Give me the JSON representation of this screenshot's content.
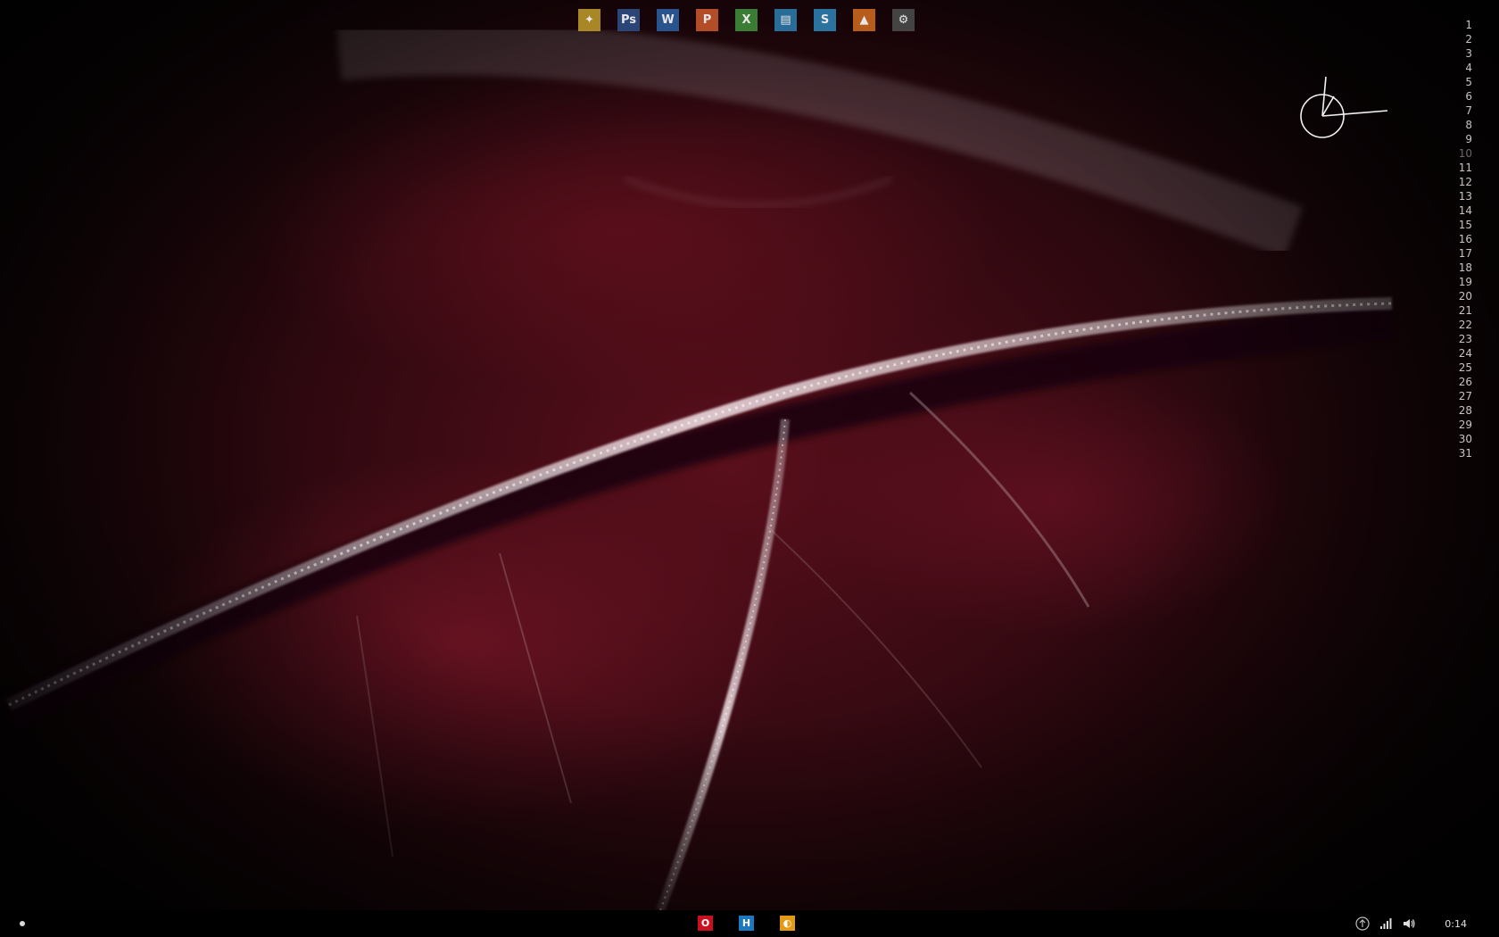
{
  "launcher": {
    "items": [
      {
        "name": "Launcher",
        "icon": "rocket-icon",
        "color": "#b9962a",
        "glyph": "✦"
      },
      {
        "name": "Photoshop",
        "icon": "photoshop-icon",
        "color": "#2d4d82",
        "glyph": "Ps"
      },
      {
        "name": "Word",
        "icon": "word-icon",
        "color": "#2a5c9c",
        "glyph": "W"
      },
      {
        "name": "PowerPoint",
        "icon": "powerpoint-icon",
        "color": "#c4552b",
        "glyph": "P"
      },
      {
        "name": "Excel",
        "icon": "excel-icon",
        "color": "#3f8a3a",
        "glyph": "X"
      },
      {
        "name": "Explorer",
        "icon": "folder-icon",
        "color": "#2b78a8",
        "glyph": "▤"
      },
      {
        "name": "Skype",
        "icon": "skype-icon",
        "color": "#2c7fb0",
        "glyph": "S"
      },
      {
        "name": "VLC",
        "icon": "vlc-icon",
        "color": "#c9661e",
        "glyph": "▲"
      },
      {
        "name": "Settings",
        "icon": "gear-icon",
        "color": "#4a4a4a",
        "glyph": "⚙"
      }
    ]
  },
  "calendar": {
    "days": [
      "1",
      "2",
      "3",
      "4",
      "5",
      "6",
      "7",
      "8",
      "9",
      "10",
      "11",
      "12",
      "13",
      "14",
      "15",
      "16",
      "17",
      "18",
      "19",
      "20",
      "21",
      "22",
      "23",
      "24",
      "25",
      "26",
      "27",
      "28",
      "29",
      "30",
      "31"
    ],
    "muted": [
      "10"
    ]
  },
  "taskbar": {
    "pinned": [
      {
        "name": "Opera",
        "icon": "opera-icon",
        "color": "#c8101e",
        "glyph": "O"
      },
      {
        "name": "App",
        "icon": "h-app-icon",
        "color": "#1c79c0",
        "glyph": "H"
      },
      {
        "name": "App",
        "icon": "orange-app-icon",
        "color": "#e39a14",
        "glyph": "◐"
      }
    ],
    "tray": [
      {
        "icon": "upload-icon"
      },
      {
        "icon": "signal-icon"
      },
      {
        "icon": "volume-icon"
      }
    ],
    "time": "0:14"
  }
}
